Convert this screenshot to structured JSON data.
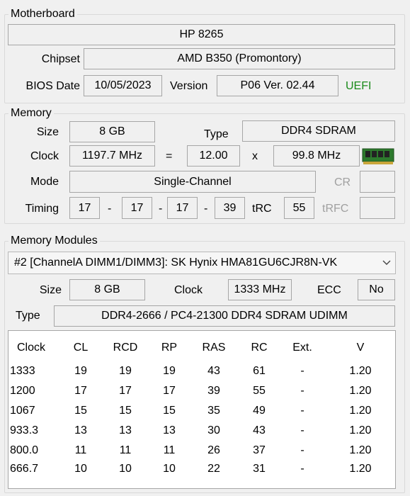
{
  "motherboard": {
    "title": "Motherboard",
    "model": "HP 8265",
    "chipset_label": "Chipset",
    "chipset": "AMD B350 (Promontory)",
    "bios_date_label": "BIOS Date",
    "bios_date": "10/05/2023",
    "version_label": "Version",
    "version": "P06 Ver. 02.44",
    "uefi": "UEFI"
  },
  "memory": {
    "title": "Memory",
    "size_label": "Size",
    "size": "8 GB",
    "type_label": "Type",
    "type": "DDR4 SDRAM",
    "clock_label": "Clock",
    "clock": "1197.7 MHz",
    "equals": "=",
    "multiplier": "12.00",
    "times": "x",
    "bus": "99.8 MHz",
    "mode_label": "Mode",
    "mode": "Single-Channel",
    "cr_label": "CR",
    "cr": "",
    "timing_label": "Timing",
    "timings": [
      "17",
      "17",
      "17",
      "39"
    ],
    "dash": "-",
    "trc_label": "tRC",
    "trc": "55",
    "trfc_label": "tRFC",
    "trfc": ""
  },
  "modules": {
    "title": "Memory Modules",
    "selected": "#2 [ChannelA DIMM1/DIMM3]: SK Hynix HMA81GU6CJR8N-VK",
    "size_label": "Size",
    "size": "8 GB",
    "clock_label": "Clock",
    "clock": "1333 MHz",
    "ecc_label": "ECC",
    "ecc": "No",
    "type_label": "Type",
    "type": "DDR4-2666 / PC4-21300 DDR4 SDRAM UDIMM",
    "table": {
      "headers": [
        "Clock",
        "CL",
        "RCD",
        "RP",
        "RAS",
        "RC",
        "Ext.",
        "V"
      ],
      "rows": [
        [
          "1333",
          "19",
          "19",
          "19",
          "43",
          "61",
          "-",
          "1.20"
        ],
        [
          "1200",
          "17",
          "17",
          "17",
          "39",
          "55",
          "-",
          "1.20"
        ],
        [
          "1067",
          "15",
          "15",
          "15",
          "35",
          "49",
          "-",
          "1.20"
        ],
        [
          "933.3",
          "13",
          "13",
          "13",
          "30",
          "43",
          "-",
          "1.20"
        ],
        [
          "800.0",
          "11",
          "11",
          "11",
          "26",
          "37",
          "-",
          "1.20"
        ],
        [
          "666.7",
          "10",
          "10",
          "10",
          "22",
          "31",
          "-",
          "1.20"
        ]
      ]
    }
  },
  "colors": {
    "uefi": "#1a8a1a",
    "disabled_label": "#a0a0a0"
  }
}
